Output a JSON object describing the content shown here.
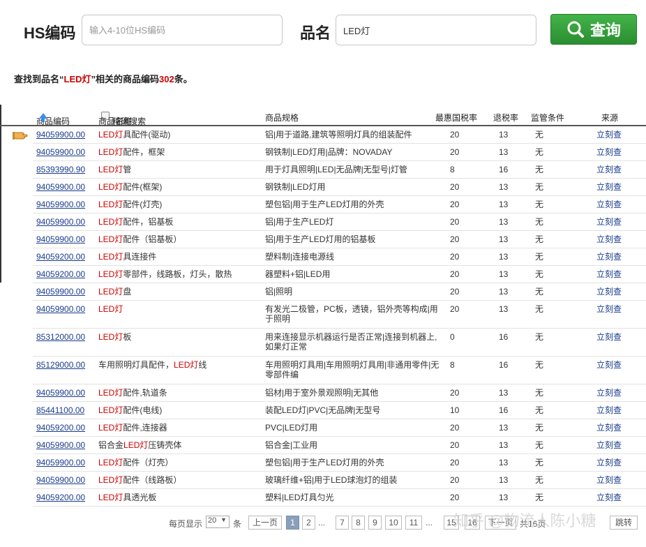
{
  "search": {
    "hs_label": "HS编码",
    "hs_placeholder": "输入4-10位HS编码",
    "hs_value": "",
    "name_label": "品名",
    "name_value": "LED灯",
    "button_label": "查询"
  },
  "summary": {
    "prefix": "查找到品名“",
    "keyword": "LED灯",
    "middle": "”相关的商品编码",
    "count": "302",
    "suffix": "条。"
  },
  "table": {
    "headers": {
      "code": "商品编码",
      "name": "商品名称",
      "exact": "精确搜索",
      "spec": "商品规格",
      "rate": "最惠国税率",
      "refund": "退税率",
      "supervision": "监管条件",
      "source": "来源"
    },
    "rows": [
      {
        "code": "94059900.00",
        "name_pre": "",
        "name_hl": "LED灯",
        "name_post": "具配件(驱动)",
        "spec": "铝|用于道路,建筑等照明灯具的组装配件",
        "rate": "20",
        "refund": "13",
        "sup": "无",
        "src": "立刻查"
      },
      {
        "code": "94059900.00",
        "name_pre": "",
        "name_hl": "LED灯",
        "name_post": "配件，框架",
        "spec": "钢铁制|LED灯用|品牌：NOVADAY",
        "rate": "20",
        "refund": "13",
        "sup": "无",
        "src": "立刻查"
      },
      {
        "code": "85393990.90",
        "name_pre": "",
        "name_hl": "LED灯",
        "name_post": "管",
        "spec": "用于灯具照明|LED|无品牌|无型号|灯管",
        "rate": "8",
        "refund": "16",
        "sup": "无",
        "src": "立刻查"
      },
      {
        "code": "94059900.00",
        "name_pre": "",
        "name_hl": "LED灯",
        "name_post": "配件(框架)",
        "spec": "钢铁制|LED灯用",
        "rate": "20",
        "refund": "13",
        "sup": "无",
        "src": "立刻查"
      },
      {
        "code": "94059900.00",
        "name_pre": "",
        "name_hl": "LED灯",
        "name_post": "配件(灯壳)",
        "spec": "塑包铝|用于生产LED灯用的外壳",
        "rate": "20",
        "refund": "13",
        "sup": "无",
        "src": "立刻查"
      },
      {
        "code": "94059900.00",
        "name_pre": "",
        "name_hl": "LED灯",
        "name_post": "配件，铝基板",
        "spec": "铝|用于生产LED灯",
        "rate": "20",
        "refund": "13",
        "sup": "无",
        "src": "立刻查"
      },
      {
        "code": "94059900.00",
        "name_pre": "",
        "name_hl": "LED灯",
        "name_post": "配件（铝基板）",
        "spec": "铝|用于生产LED灯用的铝基板",
        "rate": "20",
        "refund": "13",
        "sup": "无",
        "src": "立刻查"
      },
      {
        "code": "94059200.00",
        "name_pre": "",
        "name_hl": "LED灯",
        "name_post": "具连接件",
        "spec": "塑料制|连接电源线",
        "rate": "20",
        "refund": "13",
        "sup": "无",
        "src": "立刻查"
      },
      {
        "code": "94059200.00",
        "name_pre": "",
        "name_hl": "LED灯",
        "name_post": "零部件，线路板，灯头，散热",
        "spec": "器塑料+铝|LED用",
        "rate": "20",
        "refund": "13",
        "sup": "无",
        "src": "立刻查"
      },
      {
        "code": "94059900.00",
        "name_pre": "",
        "name_hl": "LED灯",
        "name_post": "盘",
        "spec": "铝|照明",
        "rate": "20",
        "refund": "13",
        "sup": "无",
        "src": "立刻查"
      },
      {
        "code": "94059900.00",
        "name_pre": "",
        "name_hl": "LED灯",
        "name_post": "",
        "spec": "有发光二极管，PC板，透镜，铝外壳等构成|用于照明",
        "rate": "20",
        "refund": "13",
        "sup": "无",
        "src": "立刻查"
      },
      {
        "code": "85312000.00",
        "name_pre": "",
        "name_hl": "LED灯",
        "name_post": "板",
        "spec": "用来连接显示机器运行是否正常|连接到机器上,如果灯正常",
        "rate": "0",
        "refund": "16",
        "sup": "无",
        "src": "立刻查"
      },
      {
        "code": "85129000.00",
        "name_pre": "车用照明灯具配件，",
        "name_hl": "LED灯",
        "name_post": "线",
        "spec": "车用照明灯具用|车用照明灯具用|非通用零件|无零部件编",
        "rate": "8",
        "refund": "16",
        "sup": "无",
        "src": "立刻查"
      },
      {
        "code": "94059900.00",
        "name_pre": "",
        "name_hl": "LED灯",
        "name_post": "配件,轨道条",
        "spec": "铝材|用于室外景观照明|无其他",
        "rate": "20",
        "refund": "13",
        "sup": "无",
        "src": "立刻查"
      },
      {
        "code": "85441100.00",
        "name_pre": "",
        "name_hl": "LED灯",
        "name_post": "配件(电线)",
        "spec": "装配LED灯|PVC|无品牌|无型号",
        "rate": "10",
        "refund": "16",
        "sup": "无",
        "src": "立刻查"
      },
      {
        "code": "94059200.00",
        "name_pre": "",
        "name_hl": "LED灯",
        "name_post": "配件,连接器",
        "spec": "PVC|LED灯用",
        "rate": "20",
        "refund": "13",
        "sup": "无",
        "src": "立刻查"
      },
      {
        "code": "94059900.00",
        "name_pre": "铝合金",
        "name_hl": "LED灯",
        "name_post": "压铸壳体",
        "spec": "铝合金|工业用",
        "rate": "20",
        "refund": "13",
        "sup": "无",
        "src": "立刻查"
      },
      {
        "code": "94059900.00",
        "name_pre": "",
        "name_hl": "LED灯",
        "name_post": "配件（灯壳）",
        "spec": "塑包铝|用于生产LED灯用的外壳",
        "rate": "20",
        "refund": "13",
        "sup": "无",
        "src": "立刻查"
      },
      {
        "code": "94059900.00",
        "name_pre": "",
        "name_hl": "LED灯",
        "name_post": "配件（线路板）",
        "spec": "玻璃纤维+铝|用于LED球泡灯的组装",
        "rate": "20",
        "refund": "13",
        "sup": "无",
        "src": "立刻查"
      },
      {
        "code": "94059200.00",
        "name_pre": "",
        "name_hl": "LED灯",
        "name_post": "具透光板",
        "spec": "塑料|LED灯具匀光",
        "rate": "20",
        "refund": "13",
        "sup": "无",
        "src": "立刻查"
      }
    ]
  },
  "pagination": {
    "per_page_label": "每页显示",
    "per_page_value": "20",
    "per_page_unit": "条",
    "prev": "上一页",
    "pages": [
      {
        "label": "1",
        "current": true
      },
      {
        "label": "2",
        "current": false
      },
      {
        "label": "...",
        "ellipsis": true
      },
      {
        "label": "7",
        "current": false
      },
      {
        "label": "8",
        "current": false
      },
      {
        "label": "9",
        "current": false
      },
      {
        "label": "10",
        "current": false
      },
      {
        "label": "11",
        "current": false
      },
      {
        "label": "...",
        "ellipsis": true
      },
      {
        "label": "15",
        "current": false
      },
      {
        "label": "16",
        "current": false
      }
    ],
    "next": "下一页",
    "total": "共16页",
    "jump": "跳转"
  },
  "watermark": "知乎 @物流人陈小糖"
}
